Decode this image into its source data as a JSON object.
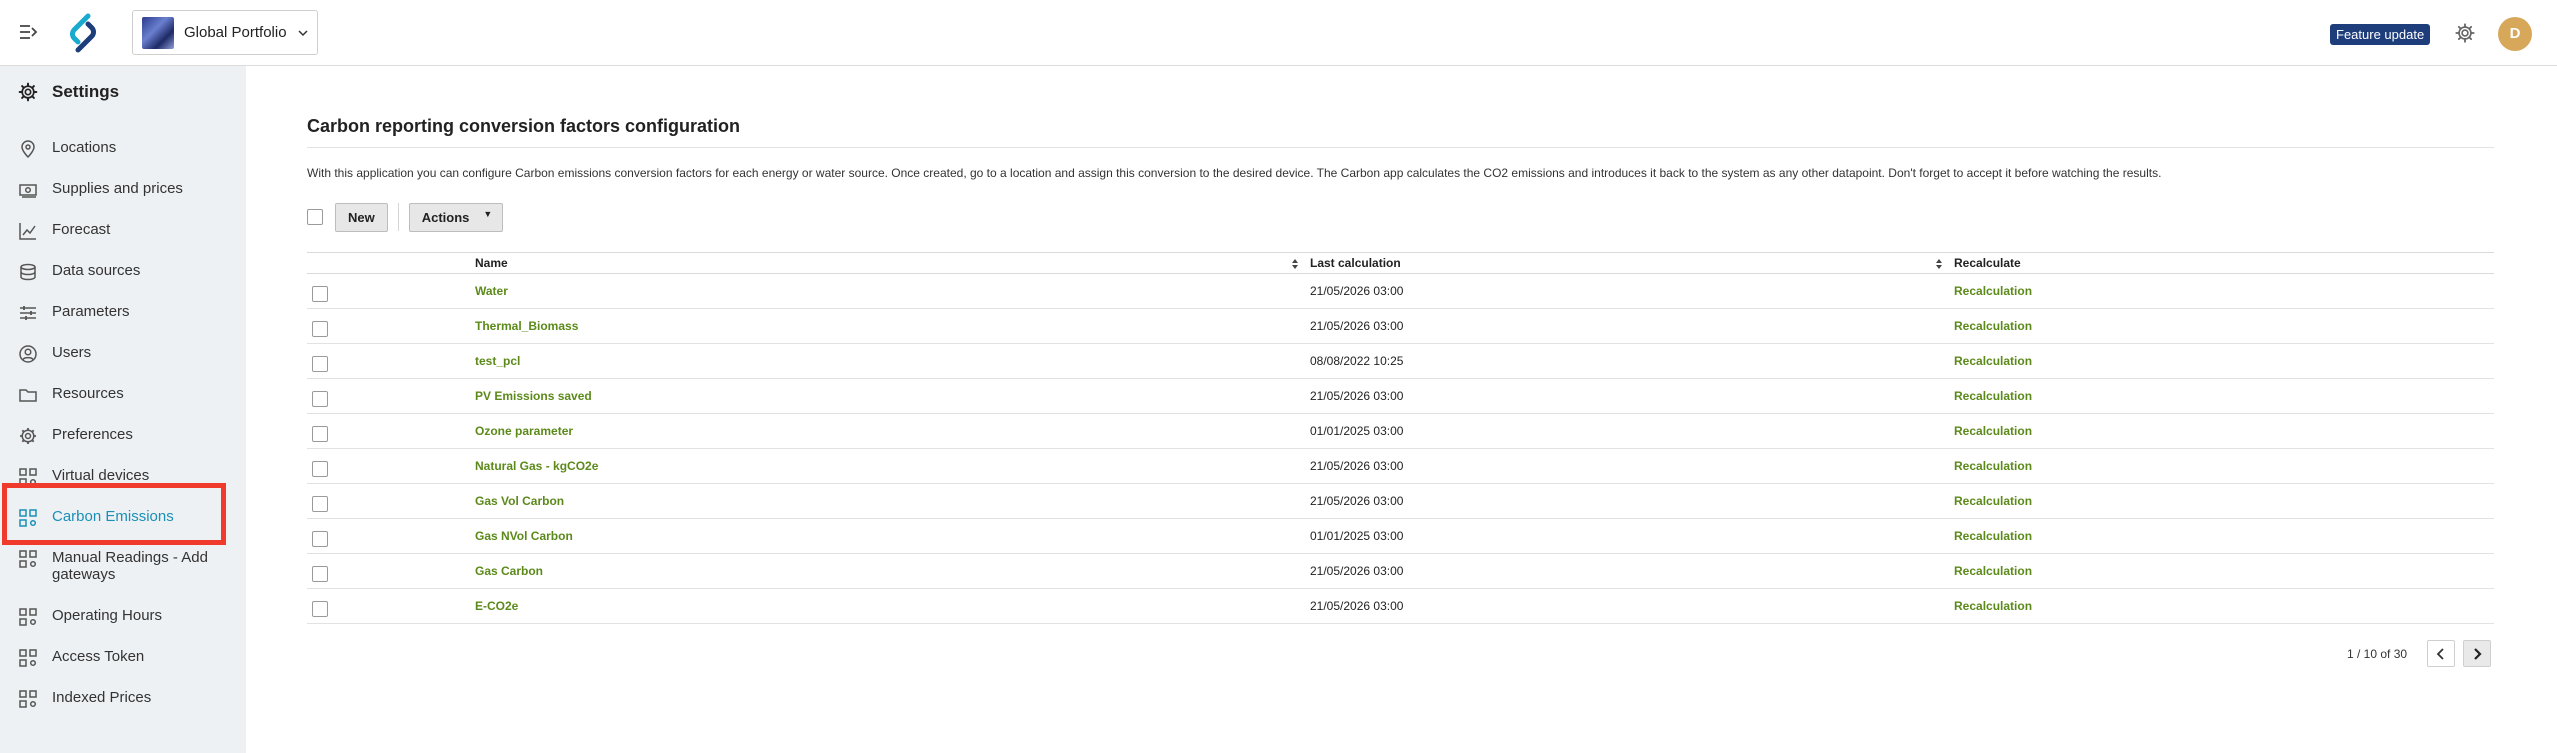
{
  "header": {
    "portfolio_label": "Global Portfolio",
    "feature_badge": "Feature update",
    "avatar_initial": "D",
    "badge_color": "#1e3d7b",
    "avatar_color": "#d7a85a"
  },
  "sidebar": {
    "title": "Settings",
    "items": [
      {
        "label": "Locations",
        "icon": "location-pin-icon"
      },
      {
        "label": "Supplies and prices",
        "icon": "money-icon"
      },
      {
        "label": "Forecast",
        "icon": "chart-icon"
      },
      {
        "label": "Data sources",
        "icon": "database-icon"
      },
      {
        "label": "Parameters",
        "icon": "sliders-icon"
      },
      {
        "label": "Users",
        "icon": "user-circle-icon"
      },
      {
        "label": "Resources",
        "icon": "folder-icon"
      },
      {
        "label": "Preferences",
        "icon": "gear-icon"
      },
      {
        "label": "Virtual devices",
        "icon": "apps-gear-icon"
      },
      {
        "label": "Carbon Emissions",
        "icon": "apps-gear-icon",
        "active": true
      },
      {
        "label": "Manual Readings - Add gateways",
        "icon": "apps-gear-icon"
      },
      {
        "label": "Operating Hours",
        "icon": "apps-gear-icon"
      },
      {
        "label": "Access Token",
        "icon": "apps-gear-icon"
      },
      {
        "label": "Indexed Prices",
        "icon": "apps-gear-icon"
      }
    ],
    "active_color": "#1a8fb8",
    "highlight_color": "#f03a2b"
  },
  "main": {
    "title": "Carbon reporting conversion factors configuration",
    "description": "With this application you can configure Carbon emissions conversion factors for each energy or water source. Once created, go to a location and assign this conversion to the desired device. The Carbon app calculates the CO2 emissions and introduces it back to the system as any other datapoint. Don't forget to accept it before watching the results.",
    "toolbar": {
      "new_label": "New",
      "actions_label": "Actions",
      "actions_caret": "▼"
    },
    "table": {
      "columns": [
        "Name",
        "Last calculation",
        "Recalculate"
      ],
      "rows": [
        {
          "name": "Water",
          "last_calculation": "21/05/2026 03:00",
          "recalculate": "Recalculation"
        },
        {
          "name": "Thermal_Biomass",
          "last_calculation": "21/05/2026 03:00",
          "recalculate": "Recalculation"
        },
        {
          "name": "test_pcl",
          "last_calculation": "08/08/2022 10:25",
          "recalculate": "Recalculation"
        },
        {
          "name": "PV Emissions saved",
          "last_calculation": "21/05/2026 03:00",
          "recalculate": "Recalculation"
        },
        {
          "name": "Ozone parameter",
          "last_calculation": "01/01/2025 03:00",
          "recalculate": "Recalculation"
        },
        {
          "name": "Natural Gas - kgCO2e",
          "last_calculation": "21/05/2026 03:00",
          "recalculate": "Recalculation"
        },
        {
          "name": "Gas Vol Carbon",
          "last_calculation": "21/05/2026 03:00",
          "recalculate": "Recalculation"
        },
        {
          "name": "Gas NVol Carbon",
          "last_calculation": "01/01/2025 03:00",
          "recalculate": "Recalculation"
        },
        {
          "name": "Gas Carbon",
          "last_calculation": "21/05/2026 03:00",
          "recalculate": "Recalculation"
        },
        {
          "name": "E-CO2e",
          "last_calculation": "21/05/2026 03:00",
          "recalculate": "Recalculation"
        }
      ],
      "link_color": "#5c8a1a"
    },
    "pagination": {
      "text": "1  /  10  of  30"
    }
  }
}
